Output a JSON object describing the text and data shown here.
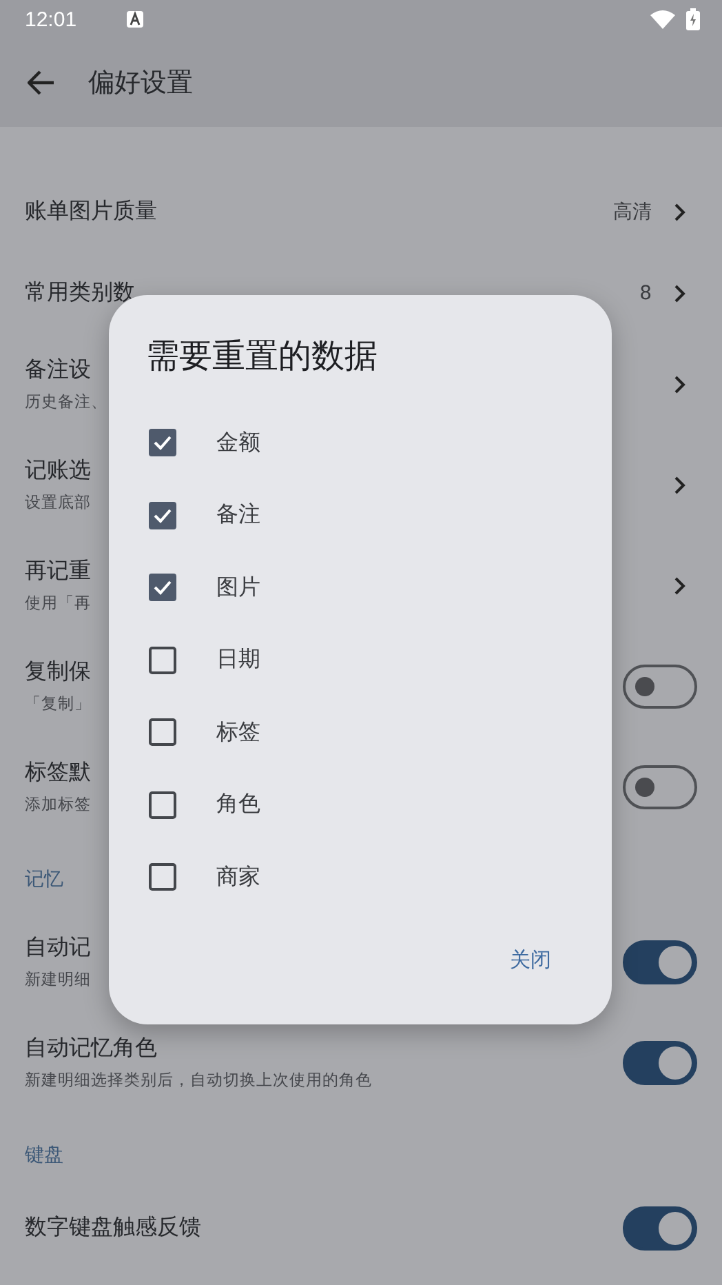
{
  "status_bar": {
    "time": "12:01"
  },
  "toolbar": {
    "title": "偏好设置"
  },
  "settings": [
    {
      "kind": "nav",
      "title": "账单图片质量",
      "value": "高清"
    },
    {
      "kind": "nav",
      "title": "常用类别数",
      "value": "8"
    },
    {
      "kind": "nav",
      "title": "备注设",
      "subtitle": "历史备注、"
    },
    {
      "kind": "nav",
      "title": "记账选",
      "subtitle": "设置底部"
    },
    {
      "kind": "nav",
      "title": "再记重",
      "subtitle": "使用「再"
    },
    {
      "kind": "toggle",
      "title": "复制保",
      "subtitle": "「复制」",
      "on": false
    },
    {
      "kind": "toggle",
      "title": "标签默",
      "subtitle": "添加标签",
      "on": false
    },
    {
      "kind": "header",
      "title": "记忆"
    },
    {
      "kind": "toggle",
      "title": "自动记",
      "subtitle": "新建明细",
      "on": true
    },
    {
      "kind": "toggle",
      "title": "自动记忆角色",
      "subtitle": "新建明细选择类别后，自动切换上次使用的角色",
      "on": true
    },
    {
      "kind": "header",
      "title": "键盘"
    },
    {
      "kind": "toggle",
      "title": "数字键盘触感反馈",
      "on": true
    }
  ],
  "dialog": {
    "title": "需要重置的数据",
    "options": [
      {
        "label": "金额",
        "checked": true
      },
      {
        "label": "备注",
        "checked": true
      },
      {
        "label": "图片",
        "checked": true
      },
      {
        "label": "日期",
        "checked": false
      },
      {
        "label": "标签",
        "checked": false
      },
      {
        "label": "角色",
        "checked": false
      },
      {
        "label": "商家",
        "checked": false
      }
    ],
    "button": "关闭"
  }
}
